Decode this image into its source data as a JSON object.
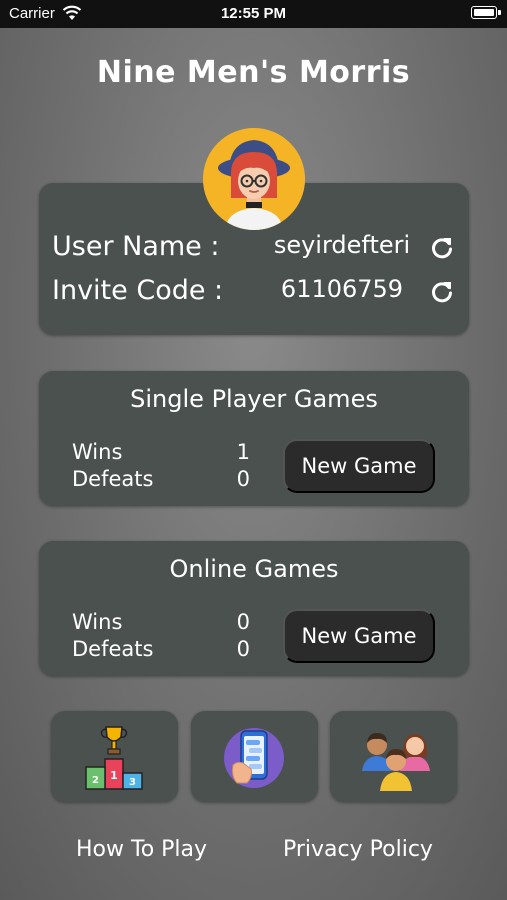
{
  "status_bar": {
    "carrier": "Carrier",
    "time": "12:55 PM"
  },
  "app": {
    "title": "Nine Men's Morris"
  },
  "user": {
    "username_label": "User Name :",
    "username_value": "seyirdefteri",
    "invite_label": "Invite Code :",
    "invite_value": "61106759"
  },
  "single_player": {
    "title": "Single Player Games",
    "wins_label": "Wins",
    "wins_value": "1",
    "defeats_label": "Defeats",
    "defeats_value": "0",
    "new_game_label": "New Game"
  },
  "online": {
    "title": "Online Games",
    "wins_label": "Wins",
    "wins_value": "0",
    "defeats_label": "Defeats",
    "defeats_value": "0",
    "new_game_label": "New Game"
  },
  "bottom_tiles": [
    {
      "icon": "podium-trophy-icon"
    },
    {
      "icon": "phone-chat-icon"
    },
    {
      "icon": "friends-group-icon"
    }
  ],
  "links": {
    "how_to_play": "How To Play",
    "privacy_policy": "Privacy Policy"
  },
  "colors": {
    "card": "#4a514e",
    "button": "#2b2b2b",
    "avatar_bg": "#f5b326"
  }
}
